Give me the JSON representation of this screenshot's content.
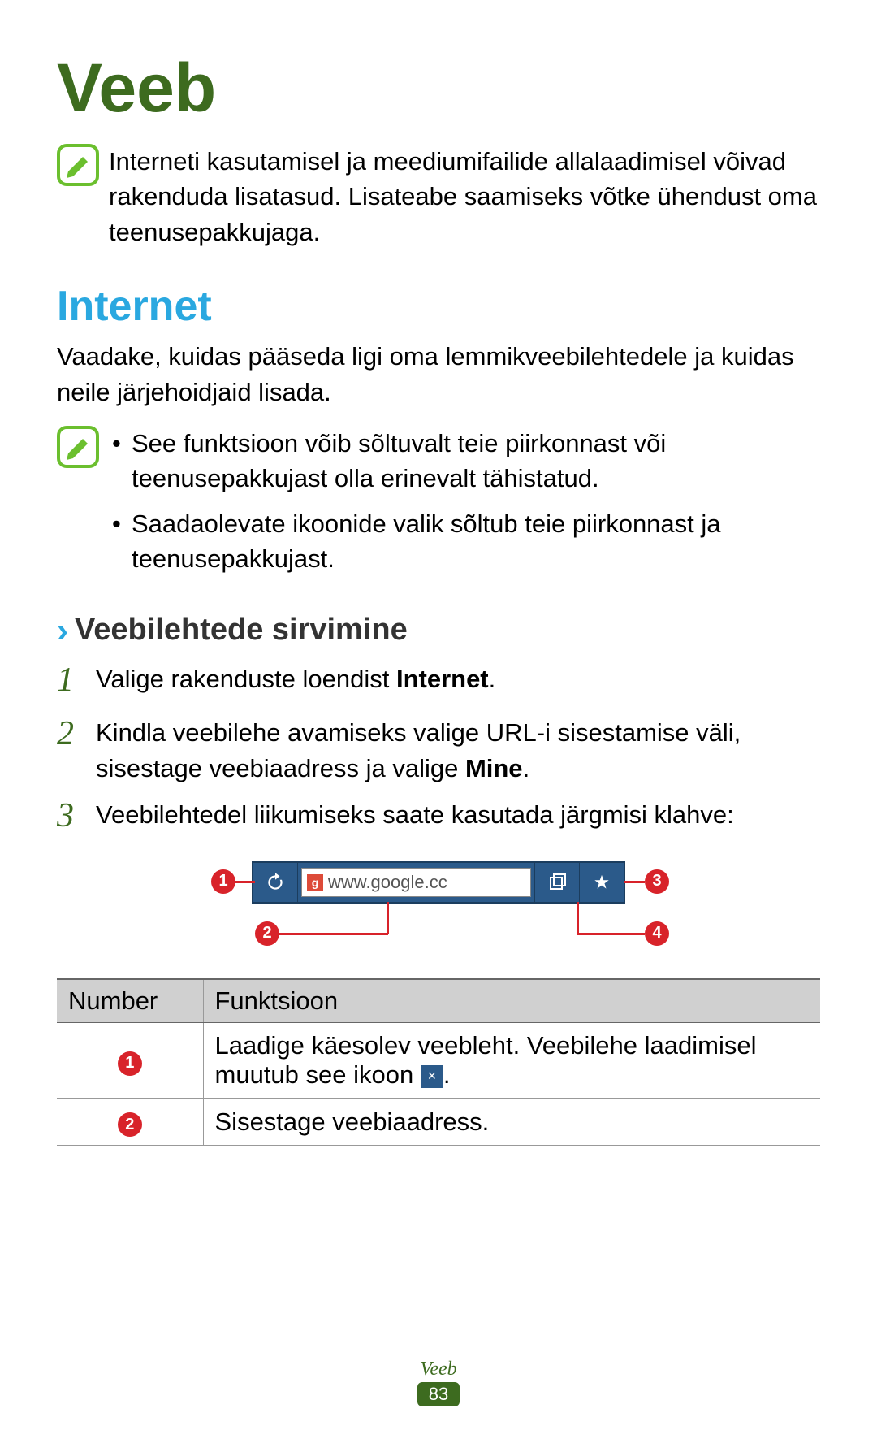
{
  "title": "Veeb",
  "top_note": "Interneti kasutamisel ja meediumifailide allalaadimisel võivad rakenduda lisatasud. Lisateabe saamiseks võtke ühendust oma teenusepakkujaga.",
  "section": {
    "heading": "Internet",
    "description": "Vaadake, kuidas pääseda ligi oma lemmikveebilehtedele ja kuidas neile järjehoidjaid lisada.",
    "notes": [
      "See funktsioon võib sõltuvalt teie piirkonnast või teenusepakkujast olla erinevalt tähistatud.",
      "Saadaolevate ikoonide valik sõltub teie piirkonnast ja teenusepakkujast."
    ]
  },
  "subheading": "Veebilehtede sirvimine",
  "steps": [
    {
      "num": "1",
      "pre": "Valige rakenduste loendist ",
      "bold": "Internet",
      "post": "."
    },
    {
      "num": "2",
      "pre": "Kindla veebilehe avamiseks valige URL-i sisestamise väli, sisestage veebiaadress ja valige ",
      "bold": "Mine",
      "post": "."
    },
    {
      "num": "3",
      "pre": "Veebilehtedel liikumiseks saate kasutada järgmisi klahve:",
      "bold": "",
      "post": ""
    }
  ],
  "browser": {
    "url_text": "www.google.cc",
    "favicon_letter": "g",
    "markers": {
      "m1": "1",
      "m2": "2",
      "m3": "3",
      "m4": "4"
    }
  },
  "table": {
    "headers": {
      "col1": "Number",
      "col2": "Funktsioon"
    },
    "rows": [
      {
        "marker": "1",
        "text_pre": "Laadige käesolev veebleht. Veebilehe laadimisel muutub see ikoon ",
        "icon": "×",
        "text_post": "."
      },
      {
        "marker": "2",
        "text_pre": "Sisestage veebiaadress.",
        "icon": "",
        "text_post": ""
      }
    ]
  },
  "footer": {
    "title": "Veeb",
    "page": "83"
  }
}
